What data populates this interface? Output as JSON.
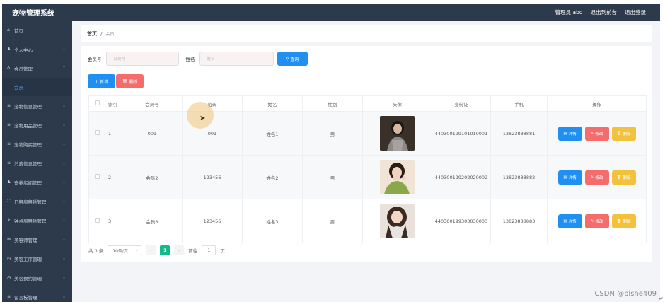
{
  "header": {
    "title": "宠物管理系统",
    "user": "管理员 abo",
    "back_to_front": "退出到前台",
    "logout": "退出登录"
  },
  "sidebar": {
    "items": [
      {
        "label": "首页",
        "icon": "home-icon",
        "arrow": false
      },
      {
        "label": "个人中心",
        "icon": "user-icon",
        "arrow": true
      },
      {
        "label": "会员管理",
        "icon": "member-icon",
        "arrow": true,
        "expanded": true
      },
      {
        "label": "宠物信息管理",
        "icon": "menu-icon",
        "arrow": true
      },
      {
        "label": "宠物用品管理",
        "icon": "menu-icon",
        "arrow": true
      },
      {
        "label": "宠物购买管理",
        "icon": "menu-icon",
        "arrow": true
      },
      {
        "label": "消费信息管理",
        "icon": "menu-icon",
        "arrow": true
      },
      {
        "label": "寄养房间管理",
        "icon": "user-icon",
        "arrow": true
      },
      {
        "label": "日租房租赁管理",
        "icon": "frame-icon",
        "arrow": true
      },
      {
        "label": "钟点房租赁管理",
        "icon": "trophy-icon",
        "arrow": true
      },
      {
        "label": "美容师管理",
        "icon": "mail-icon",
        "arrow": true
      },
      {
        "label": "美容工序管理",
        "icon": "clock-icon",
        "arrow": true
      },
      {
        "label": "美容预约管理",
        "icon": "clock-icon",
        "arrow": true
      },
      {
        "label": "留言板管理",
        "icon": "menu-icon",
        "arrow": true
      }
    ],
    "sub_item": "会员"
  },
  "breadcrumb": {
    "home": "首页",
    "separator": "/",
    "current": "会员"
  },
  "search": {
    "member_no_label": "会员号",
    "member_no_placeholder": "会员号",
    "name_label": "姓名",
    "name_placeholder": "姓名",
    "query_button": "查询"
  },
  "actions": {
    "add": "新增",
    "delete": "删除"
  },
  "table": {
    "columns": [
      "索引",
      "会员号",
      "密码",
      "姓名",
      "性别",
      "头像",
      "身份证",
      "手机",
      "操作"
    ],
    "rows": [
      {
        "index": "1",
        "member_no": "001",
        "password": "001",
        "name": "姓名1",
        "gender": "男",
        "id_card": "440300199101010001",
        "phone": "13823888881"
      },
      {
        "index": "2",
        "member_no": "会员2",
        "password": "123456",
        "name": "姓名2",
        "gender": "男",
        "id_card": "440300199202020002",
        "phone": "13823888882"
      },
      {
        "index": "3",
        "member_no": "会员3",
        "password": "123456",
        "name": "姓名3",
        "gender": "男",
        "id_card": "440300199303030003",
        "phone": "13823888883"
      }
    ],
    "op_detail": "详情",
    "op_edit": "修改",
    "op_remove": "删除"
  },
  "pagination": {
    "total": "共 3 条",
    "page_size": "10条/页",
    "current_page": "1",
    "goto_label": "前往",
    "goto_value": "1",
    "page_suffix": "页"
  },
  "watermark": "CSDN @bishe409"
}
